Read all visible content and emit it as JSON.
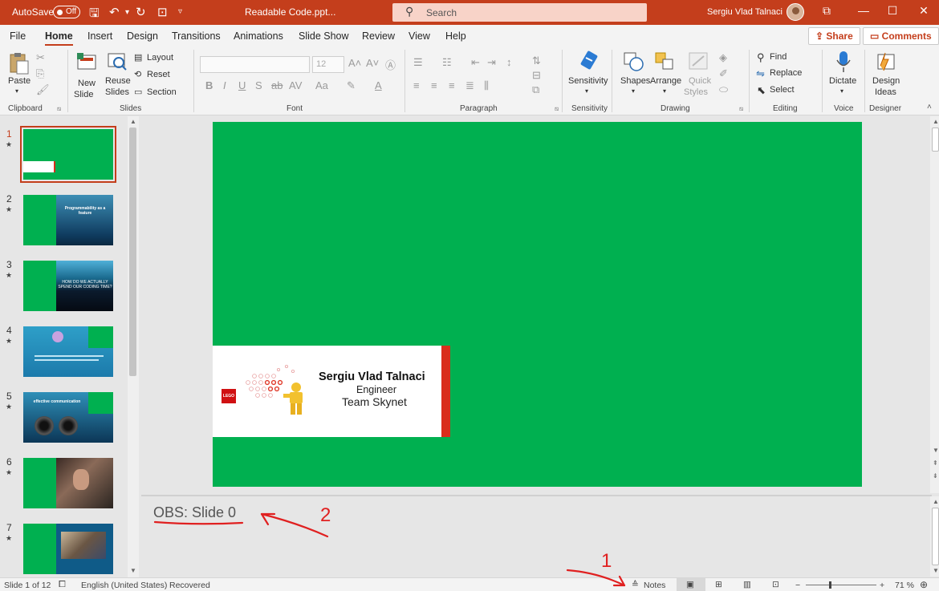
{
  "titlebar": {
    "autosave_label": "AutoSave",
    "autosave_state": "Off",
    "doc_title": "Readable Code.ppt...",
    "search_placeholder": "Search",
    "user_name": "Sergiu Vlad Talnaci"
  },
  "tabs": [
    "File",
    "Home",
    "Insert",
    "Design",
    "Transitions",
    "Animations",
    "Slide Show",
    "Review",
    "View",
    "Help"
  ],
  "active_tab": "Home",
  "share_label": "Share",
  "comments_label": "Comments",
  "ribbon": {
    "clipboard": {
      "paste": "Paste",
      "label": "Clipboard"
    },
    "slides": {
      "new_slide_1": "New",
      "new_slide_2": "Slide",
      "reuse_1": "Reuse",
      "reuse_2": "Slides",
      "layout": "Layout",
      "reset": "Reset",
      "section": "Section",
      "label": "Slides"
    },
    "font": {
      "size": "12",
      "label": "Font"
    },
    "paragraph": {
      "label": "Paragraph"
    },
    "sensitivity": {
      "button": "Sensitivity",
      "label": "Sensitivity"
    },
    "drawing": {
      "shapes": "Shapes",
      "arrange": "Arrange",
      "quick_1": "Quick",
      "quick_2": "Styles",
      "label": "Drawing"
    },
    "editing": {
      "find": "Find",
      "replace": "Replace",
      "select": "Select",
      "label": "Editing"
    },
    "voice": {
      "dictate": "Dictate",
      "label": "Voice"
    },
    "designer": {
      "ideas_1": "Design",
      "ideas_2": "Ideas",
      "label": "Designer"
    }
  },
  "slides": [
    {
      "num": "1",
      "text": ""
    },
    {
      "num": "2",
      "text": "Programmability as a feature"
    },
    {
      "num": "3",
      "text": "HOW DO WE ACTUALLY SPEND OUR CODING TIME?"
    },
    {
      "num": "4",
      "text": ""
    },
    {
      "num": "5",
      "text": "effective communication"
    },
    {
      "num": "6",
      "text": ""
    },
    {
      "num": "7",
      "text": ""
    }
  ],
  "slide": {
    "name": "Sergiu Vlad Talnaci",
    "role": "Engineer",
    "team": "Team Skynet",
    "logo": "LEGO"
  },
  "notes_text": "OBS: Slide 0",
  "annotations": {
    "one": "1",
    "two": "2"
  },
  "status": {
    "slide_of": "Slide 1 of 12",
    "language": "English (United States)",
    "recovered": "Recovered",
    "notes_button": "Notes",
    "zoom": "71 %"
  },
  "colors": {
    "accent": "#c43e1c",
    "slide_bg": "#00b050",
    "annotation": "#e02020"
  }
}
